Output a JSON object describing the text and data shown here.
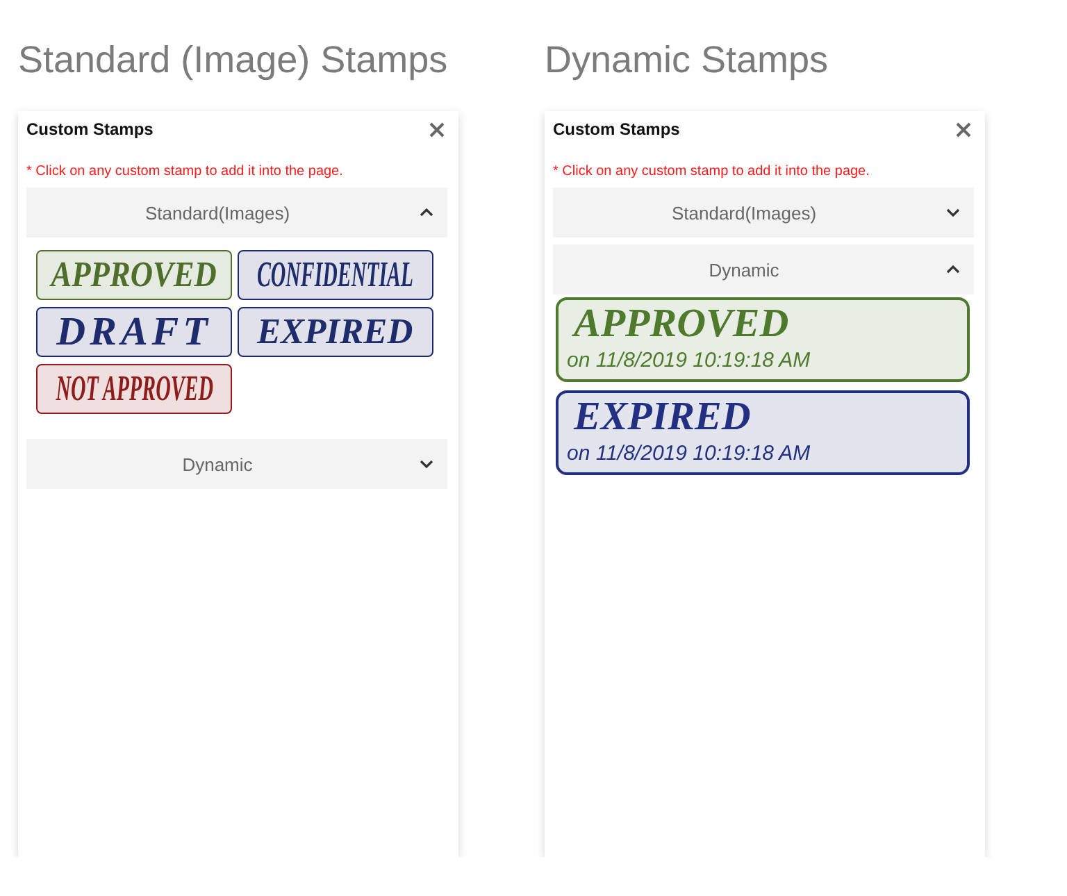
{
  "panels": [
    {
      "heading": "Standard (Image) Stamps",
      "title": "Custom Stamps",
      "note": "* Click on any custom stamp to add it into the page.",
      "sections": [
        {
          "kind": "image",
          "label": "Standard(Images)",
          "expanded": true,
          "stamps": [
            {
              "text": "APPROVED",
              "color": "#4f6e2c"
            },
            {
              "text": "CONFIDENTIAL",
              "color": "#1f2c6b"
            },
            {
              "text": "DRAFT",
              "color": "#1f2c6b"
            },
            {
              "text": "EXPIRED",
              "color": "#1f2c6b"
            },
            {
              "text": "NOT APPROVED",
              "color": "#8e1c1c"
            }
          ]
        },
        {
          "kind": "dynamic",
          "label": "Dynamic",
          "expanded": false
        }
      ]
    },
    {
      "heading": "Dynamic Stamps",
      "title": "Custom Stamps",
      "note": "* Click on any custom stamp to add it into the page.",
      "sections": [
        {
          "kind": "image",
          "label": "Standard(Images)",
          "expanded": false
        },
        {
          "kind": "dynamic",
          "label": "Dynamic",
          "expanded": true,
          "stamps": [
            {
              "text": "APPROVED",
              "date": "on 11/8/2019 10:19:18 AM",
              "color": "#4f7a2e"
            },
            {
              "text": "EXPIRED",
              "date": "on 11/8/2019 10:19:18 AM",
              "color": "#232f80"
            }
          ]
        }
      ]
    }
  ]
}
